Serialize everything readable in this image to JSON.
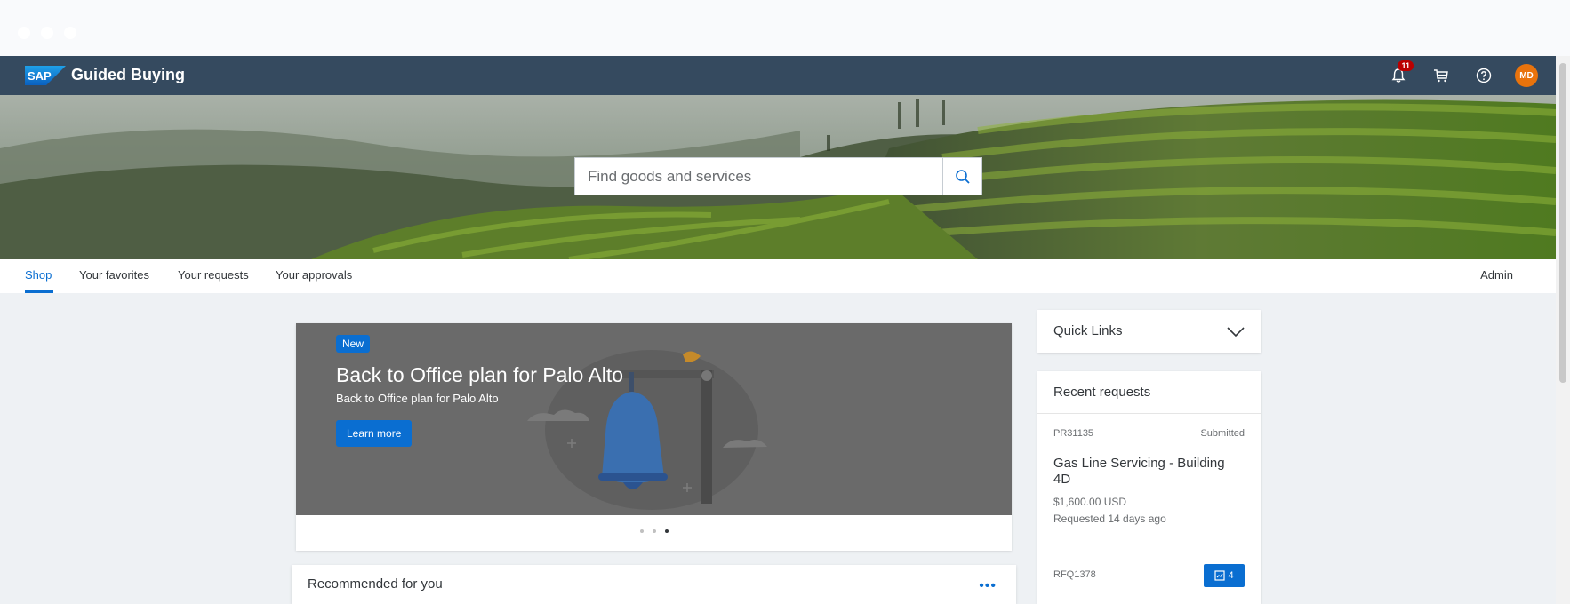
{
  "shell": {
    "logo_text": "SAP",
    "app_title": "Guided Buying",
    "notification_count": "11",
    "user_initials": "MD",
    "icons": [
      "bell-icon",
      "cart-icon",
      "help-icon"
    ],
    "colors": {
      "shellbar": "#354a5f",
      "accent": "#0a6ed1",
      "avatar": "#e9730c",
      "badge": "#bb0000"
    }
  },
  "search": {
    "placeholder": "Find goods and services"
  },
  "tabs": [
    {
      "label": "Shop",
      "active": true
    },
    {
      "label": "Your favorites",
      "active": false
    },
    {
      "label": "Your requests",
      "active": false
    },
    {
      "label": "Your approvals",
      "active": false
    }
  ],
  "admin_label": "Admin",
  "carousel": {
    "badge": "New",
    "title": "Back to Office plan for Palo Alto",
    "subtitle": "Back to Office plan for Palo Alto",
    "button": "Learn more",
    "slide_count": 3,
    "active_slide": 3
  },
  "recommended": {
    "title": "Recommended for you",
    "more": "•••"
  },
  "quick_links": {
    "title": "Quick Links"
  },
  "recent_requests": {
    "title": "Recent requests",
    "items": [
      {
        "id": "PR31135",
        "status": "Submitted",
        "title": "Gas Line Servicing - Building 4D",
        "amount": "$1,600.00 USD",
        "requested": "Requested 14 days ago"
      },
      {
        "id": "RFQ1378",
        "count": "4"
      }
    ]
  }
}
